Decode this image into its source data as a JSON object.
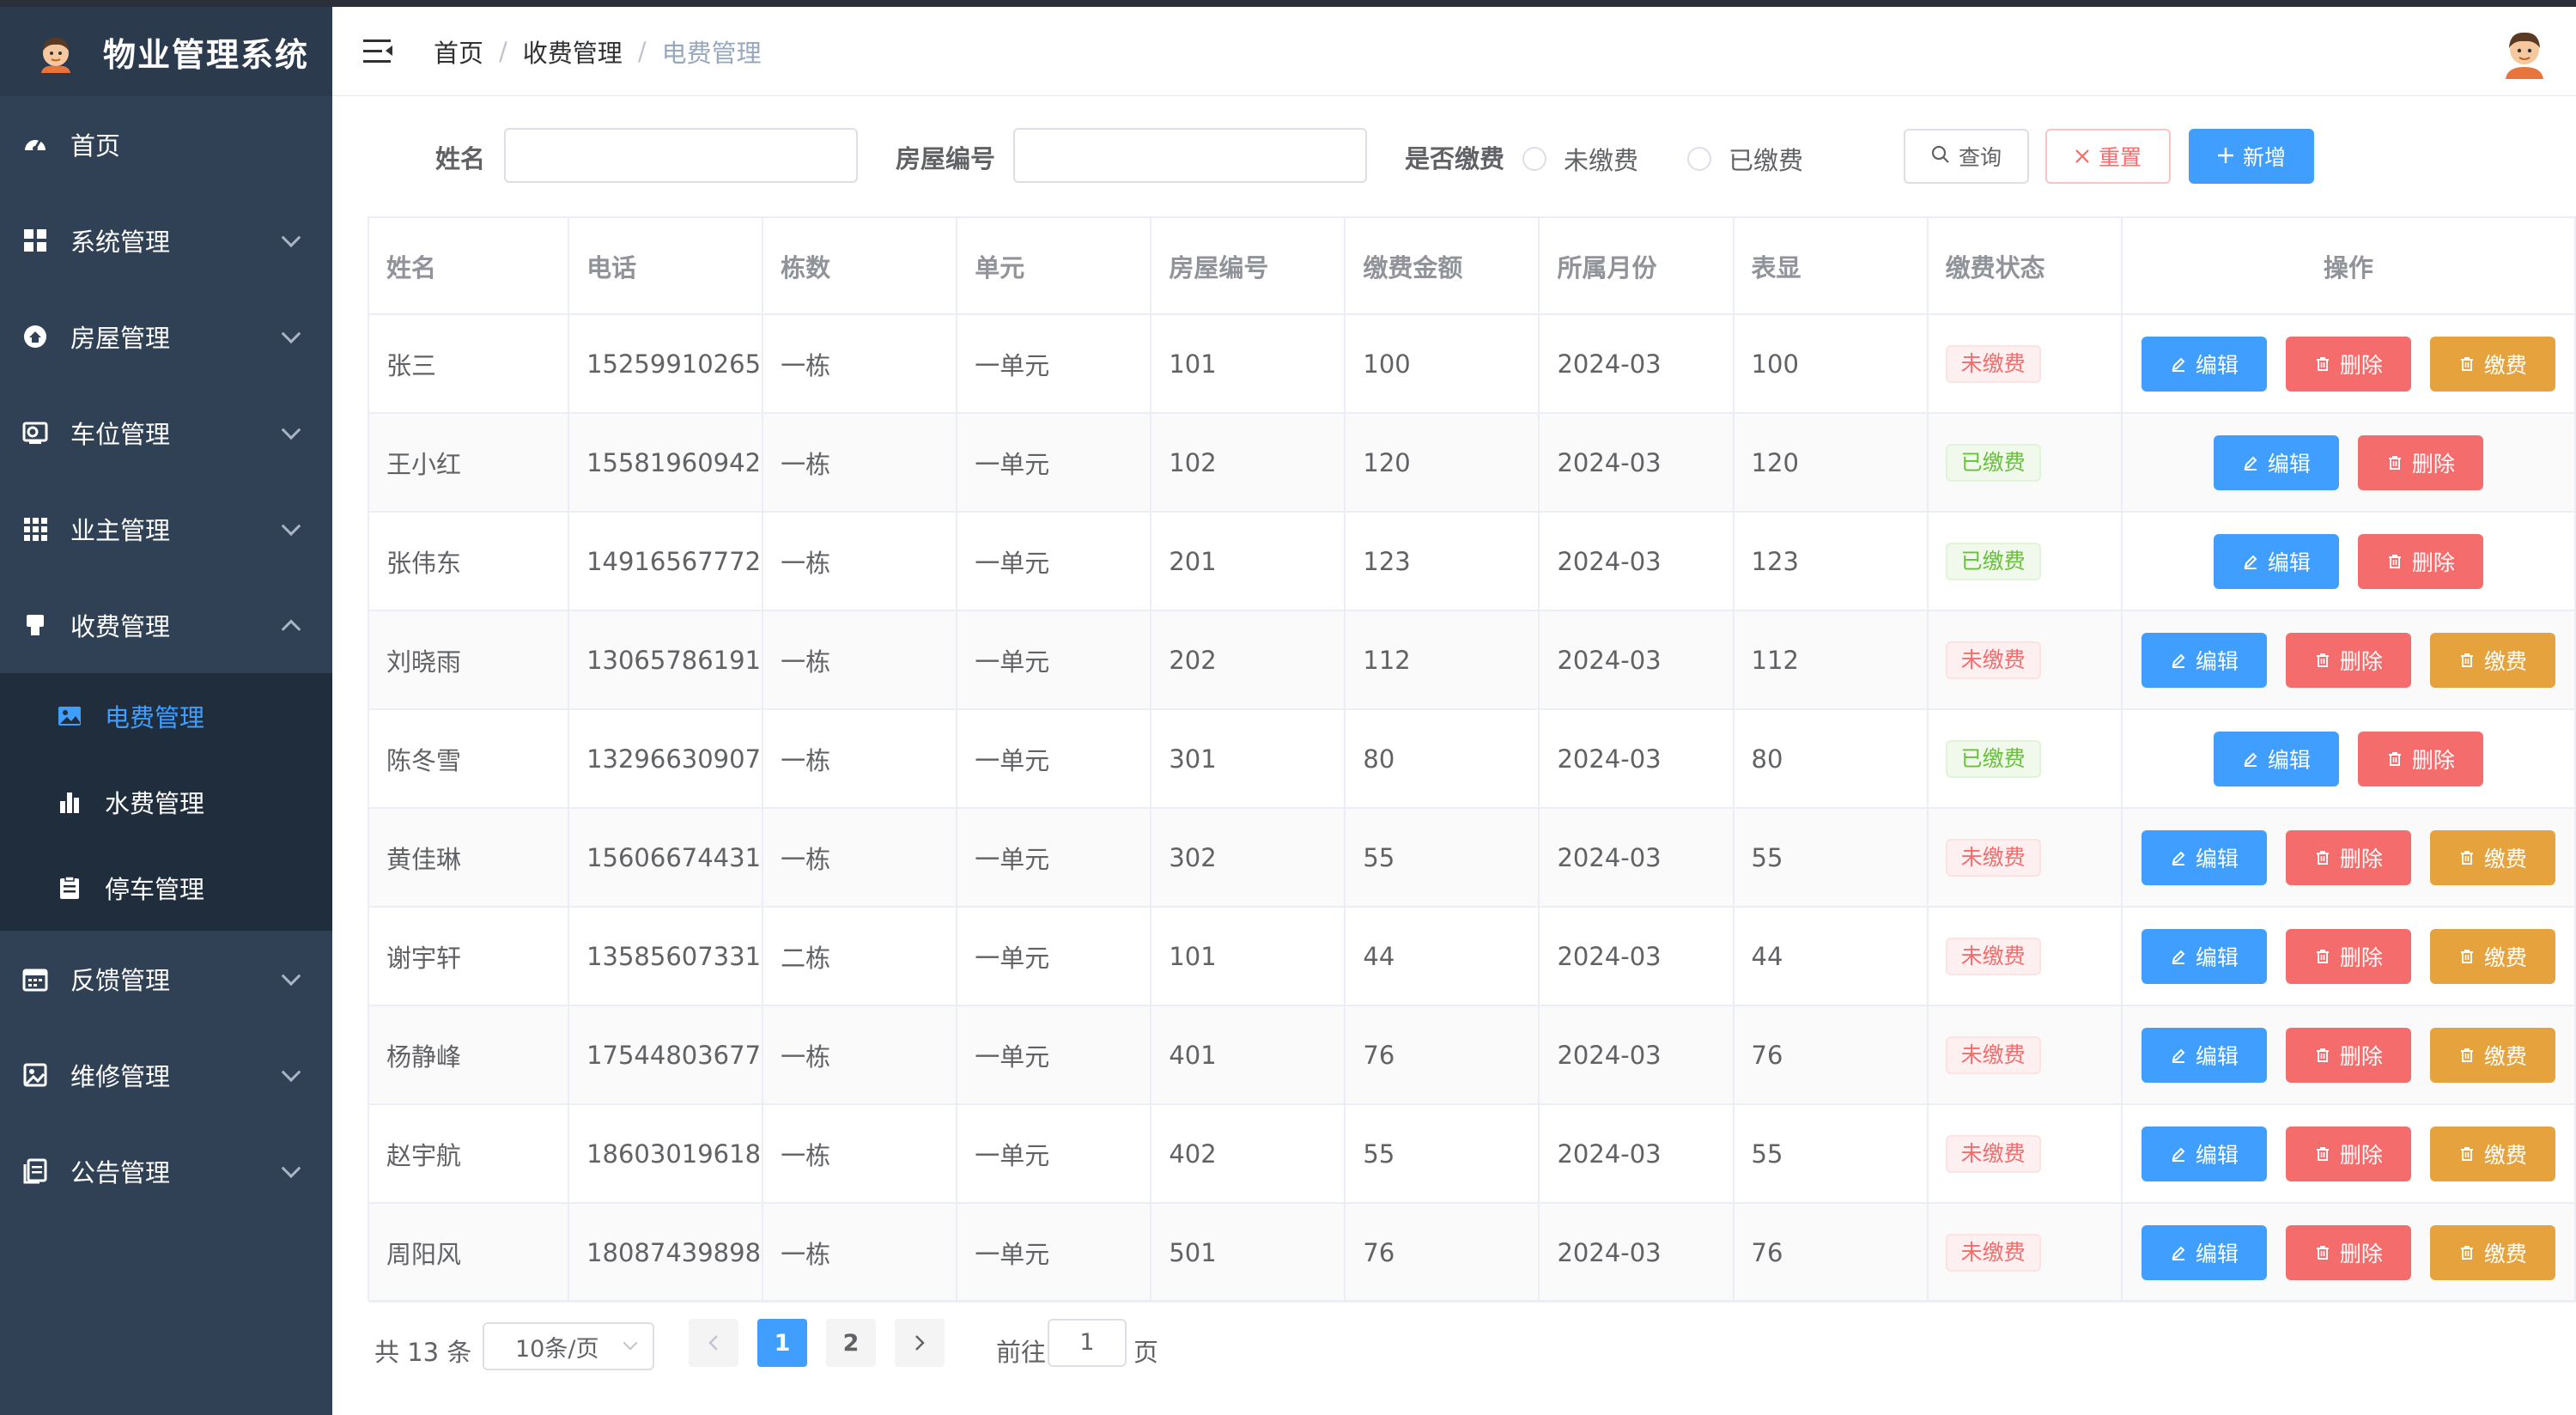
{
  "app": {
    "title": "物业管理系统"
  },
  "sidebar": {
    "items": [
      {
        "label": "首页",
        "icon": "dashboard-icon"
      },
      {
        "label": "系统管理",
        "icon": "grid-icon"
      },
      {
        "label": "房屋管理",
        "icon": "house-icon"
      },
      {
        "label": "车位管理",
        "icon": "parking-icon"
      },
      {
        "label": "业主管理",
        "icon": "apps-icon"
      },
      {
        "label": "收费管理",
        "icon": "billing-icon"
      }
    ],
    "sub_items": [
      {
        "label": "电费管理",
        "icon": "image-icon",
        "active": true
      },
      {
        "label": "水费管理",
        "icon": "bar-chart-icon"
      },
      {
        "label": "停车管理",
        "icon": "clipboard-icon"
      }
    ],
    "items_after": [
      {
        "label": "反馈管理",
        "icon": "calendar-icon"
      },
      {
        "label": "维修管理",
        "icon": "picture-icon"
      },
      {
        "label": "公告管理",
        "icon": "document-icon"
      }
    ]
  },
  "breadcrumb": {
    "home": "首页",
    "section": "收费管理",
    "current": "电费管理"
  },
  "search": {
    "name_label": "姓名",
    "name_value": "",
    "house_label": "房屋编号",
    "house_value": "",
    "paid_label": "是否缴费",
    "opt_unpaid": "未缴费",
    "opt_paid": "已缴费",
    "query_btn": "查询",
    "reset_btn": "重置",
    "add_btn": "新增"
  },
  "table": {
    "headers": [
      "姓名",
      "电话",
      "栋数",
      "单元",
      "房屋编号",
      "缴费金额",
      "所属月份",
      "表显",
      "缴费状态",
      "操作"
    ],
    "rows": [
      {
        "name": "张三",
        "phone": "15259910265",
        "building": "一栋",
        "unit": "一单元",
        "house": "101",
        "amount": "100",
        "month": "2024-03",
        "meter": "100",
        "status": "未缴费",
        "paid": false
      },
      {
        "name": "王小红",
        "phone": "15581960942",
        "building": "一栋",
        "unit": "一单元",
        "house": "102",
        "amount": "120",
        "month": "2024-03",
        "meter": "120",
        "status": "已缴费",
        "paid": true
      },
      {
        "name": "张伟东",
        "phone": "14916567772",
        "building": "一栋",
        "unit": "一单元",
        "house": "201",
        "amount": "123",
        "month": "2024-03",
        "meter": "123",
        "status": "已缴费",
        "paid": true
      },
      {
        "name": "刘晓雨",
        "phone": "13065786191",
        "building": "一栋",
        "unit": "一单元",
        "house": "202",
        "amount": "112",
        "month": "2024-03",
        "meter": "112",
        "status": "未缴费",
        "paid": false
      },
      {
        "name": "陈冬雪",
        "phone": "13296630907",
        "building": "一栋",
        "unit": "一单元",
        "house": "301",
        "amount": "80",
        "month": "2024-03",
        "meter": "80",
        "status": "已缴费",
        "paid": true
      },
      {
        "name": "黄佳琳",
        "phone": "15606674431",
        "building": "一栋",
        "unit": "一单元",
        "house": "302",
        "amount": "55",
        "month": "2024-03",
        "meter": "55",
        "status": "未缴费",
        "paid": false
      },
      {
        "name": "谢宇轩",
        "phone": "13585607331",
        "building": "二栋",
        "unit": "一单元",
        "house": "101",
        "amount": "44",
        "month": "2024-03",
        "meter": "44",
        "status": "未缴费",
        "paid": false
      },
      {
        "name": "杨静峰",
        "phone": "17544803677",
        "building": "一栋",
        "unit": "一单元",
        "house": "401",
        "amount": "76",
        "month": "2024-03",
        "meter": "76",
        "status": "未缴费",
        "paid": false
      },
      {
        "name": "赵宇航",
        "phone": "18603019618",
        "building": "一栋",
        "unit": "一单元",
        "house": "402",
        "amount": "55",
        "month": "2024-03",
        "meter": "55",
        "status": "未缴费",
        "paid": false
      },
      {
        "name": "周阳风",
        "phone": "18087439898",
        "building": "一栋",
        "unit": "一单元",
        "house": "501",
        "amount": "76",
        "month": "2024-03",
        "meter": "76",
        "status": "未缴费",
        "paid": false
      }
    ],
    "actions": {
      "edit": "编辑",
      "delete": "删除",
      "pay": "缴费"
    }
  },
  "pagination": {
    "total_text": "共 13 条",
    "page_size": "10条/页",
    "pages": [
      "1",
      "2"
    ],
    "current_page": "1",
    "goto_label": "前往",
    "goto_value": "1",
    "page_suffix": "页"
  },
  "colors": {
    "primary": "#409eff",
    "danger": "#f56c6c",
    "warning": "#e6a23c",
    "success": "#67c23a",
    "sidebar": "#304156"
  }
}
